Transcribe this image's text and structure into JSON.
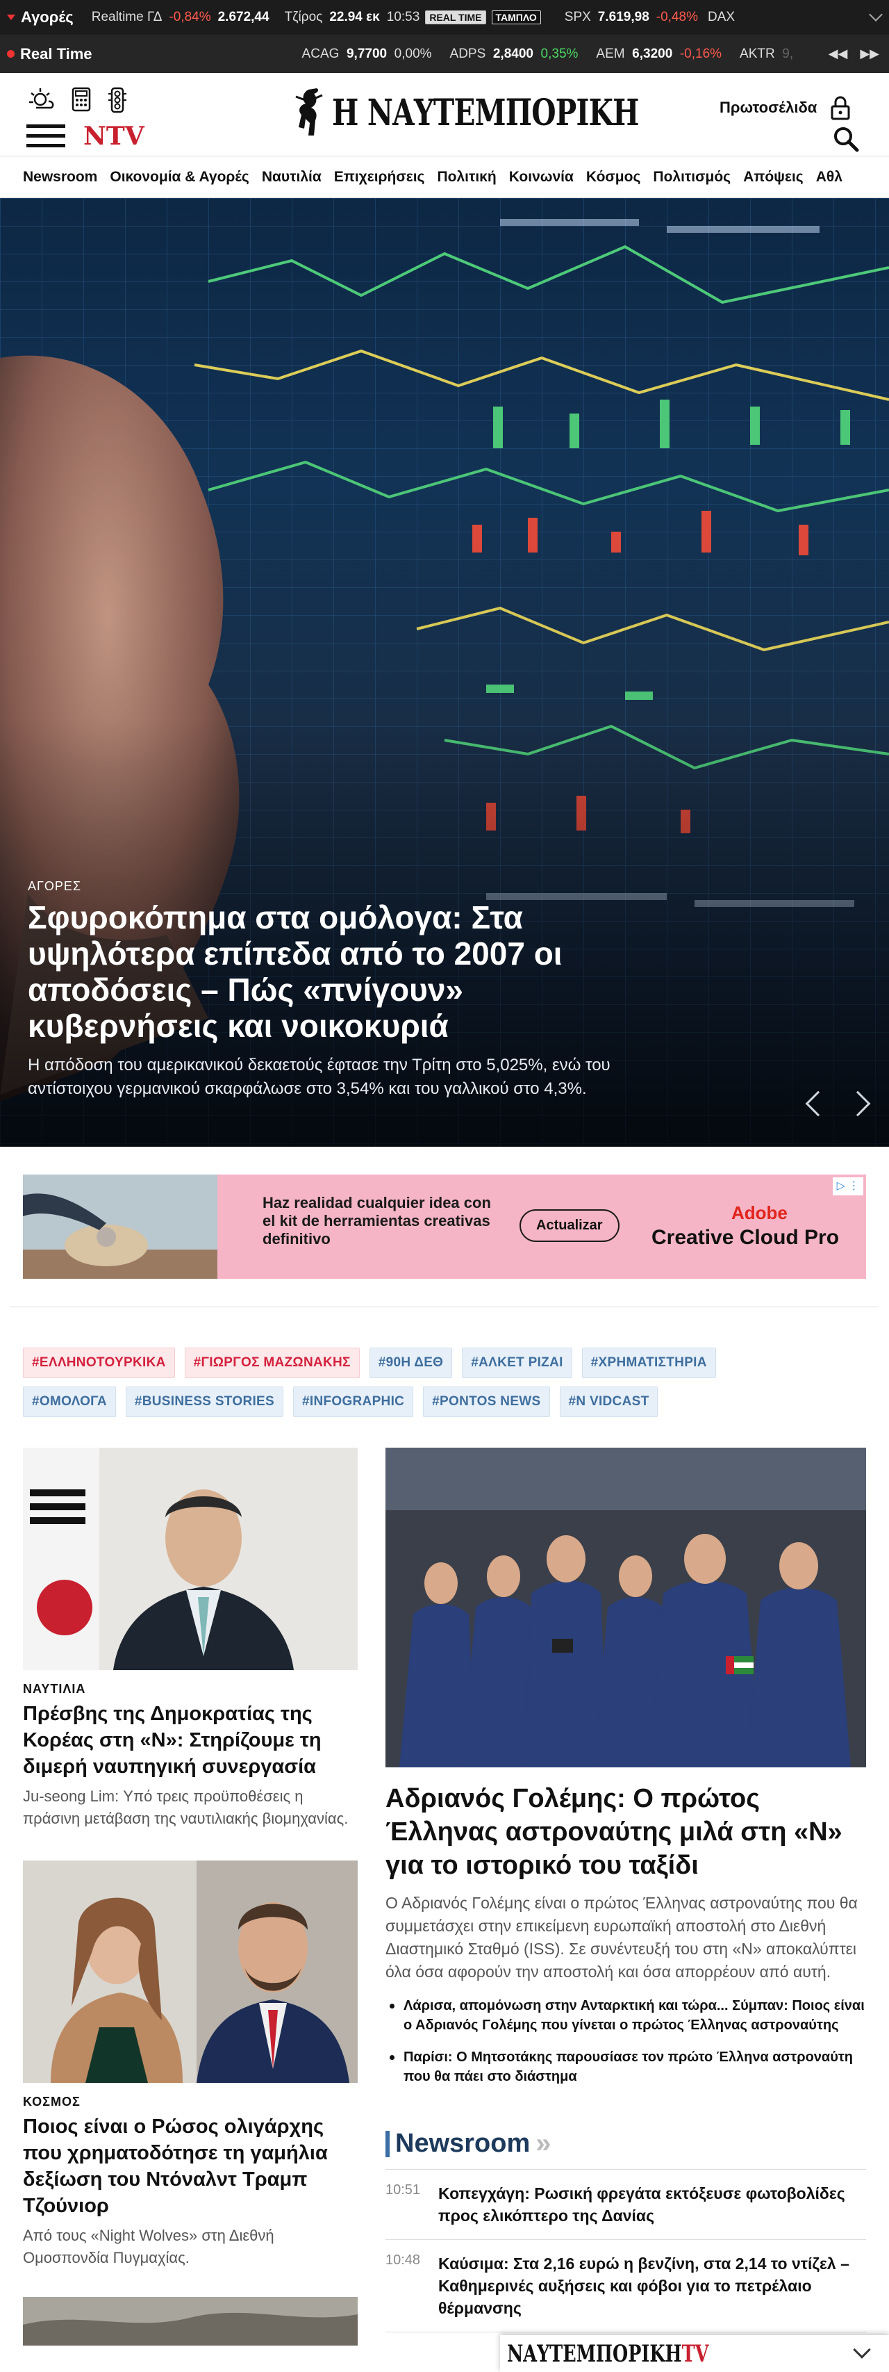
{
  "ticker_markets": {
    "label": "Αγορές",
    "index_name": "Realtime ΓΔ",
    "index_change": "-0,84%",
    "index_value": "2.672,44",
    "turnover_label": "Τζίρος",
    "turnover_value": "22.94 εκ",
    "time": "10:53",
    "realtime_badge": "REAL TIME",
    "board_badge": "ΤΑΜΠΛΟ",
    "spx_name": "SPX",
    "spx_value": "7.619,98",
    "spx_change": "-0,48%",
    "dax_name": "DAX"
  },
  "ticker_stocks": {
    "label": "Real Time",
    "items": [
      {
        "sym": "ACAG",
        "val": "9,7700",
        "chg": "0,00%"
      },
      {
        "sym": "ADPS",
        "val": "2,8400",
        "chg": "0,35%"
      },
      {
        "sym": "AEM",
        "val": "6,3200",
        "chg": "-0,16%"
      },
      {
        "sym": "AKTR",
        "val": "9,"
      }
    ],
    "prev_icon": "◀◀",
    "next_icon": "▶▶"
  },
  "header": {
    "logo_text": "Η ΝΑΥΤΕΜΠΟΡΙΚΗ",
    "ntv_label": "NTV",
    "frontpages_label": "Πρωτοσέλιδα"
  },
  "nav": [
    "Newsroom",
    "Οικονομία & Αγορές",
    "Ναυτιλία",
    "Επιχειρήσεις",
    "Πολιτική",
    "Κοινωνία",
    "Κόσμος",
    "Πολιτισμός",
    "Απόψεις",
    "Αθλ"
  ],
  "hero": {
    "kicker": "ΑΓΟΡΕΣ",
    "title": "Σφυροκόπημα στα ομόλογα: Στα υψηλότερα επίπεδα από το 2007 οι αποδόσεις – Πώς «πνίγουν» κυβερνήσεις και νοικοκυριά",
    "summary": "Η απόδοση του αμερικανικού δεκαετούς έφτασε την Τρίτη στο 5,025%, ενώ του αντίστοιχου γερμανικού σκαρφάλωσε στο 3,54% και του γαλλικού στο 4,3%."
  },
  "ad": {
    "text": "Haz realidad cualquier idea con el kit de herramientas creativas definitivo",
    "button": "Actualizar",
    "brand": "Adobe",
    "product": "Creative Cloud Pro"
  },
  "tags": [
    {
      "label": "#ΕΛΛΗΝΟΤΟΥΡΚΙΚΑ",
      "style": "r"
    },
    {
      "label": "#ΓΙΩΡΓΟΣ ΜΑΖΩΝΑΚΗΣ",
      "style": "r"
    },
    {
      "label": "#90Η ΔΕΘ",
      "style": "b"
    },
    {
      "label": "#ΑΛΚΕΤ ΡΙΖΑΙ",
      "style": "b"
    },
    {
      "label": "#ΧΡΗΜΑΤΙΣΤΗΡΙΑ",
      "style": "b"
    },
    {
      "label": "#ΟΜΟΛΟΓΑ",
      "style": "b"
    },
    {
      "label": "#BUSINESS STORIES",
      "style": "b"
    },
    {
      "label": "#INFOGRAPHIC",
      "style": "b"
    },
    {
      "label": "#PONTOS NEWS",
      "style": "b"
    },
    {
      "label": "#N VIDCAST",
      "style": "b"
    }
  ],
  "card1": {
    "category": "ΝΑΥΤΙΛΙΑ",
    "title": "Πρέσβης της Δημοκρατίας της Κορέας στη «Ν»: Στηρίζουμε τη διμερή ναυπηγική συνεργασία",
    "summary": "Ju-seong Lim: Υπό τρεις προϋποθέσεις η πράσινη μετάβαση της ναυτιλιακής βιομηχανίας."
  },
  "card2": {
    "category": "ΚΟΣΜΟΣ",
    "title": "Ποιος είναι ο Ρώσος ολιγάρχης που χρηματοδότησε τη γαμήλια δεξίωση του Ντόναλντ Τραμπ Τζούνιορ",
    "summary": "Από τους «Night Wolves» στη Διεθνή Ομοσπονδία Πυγμαχίας."
  },
  "main_story": {
    "title": "Αδριανός Γολέμης: Ο πρώτος Έλληνας αστροναύτης μιλά στη «Ν» για το ιστορικό του ταξίδι",
    "summary": "Ο Αδριανός Γολέμης είναι ο πρώτος Έλληνας αστροναύτης που θα συμμετάσχει στην επικείμενη ευρωπαϊκή αποστολή στο Διεθνή Διαστημικό Σταθμό (ISS). Σε συνέντευξή του στη «Ν» αποκαλύπτει όλα όσα αφορούν την αποστολή και όσα απορρέουν από αυτή.",
    "bullets": [
      "Λάρισα, απομόνωση στην Ανταρκτική και τώρα... Σύμπαν: Ποιος είναι ο Αδριανός Γολέμης που γίνεται ο πρώτος Έλληνας αστροναύτης",
      "Παρίσι: Ο Μητσοτάκης παρουσίασε τον πρώτο Έλληνα αστροναύτη που θα πάει στο διάστημα"
    ]
  },
  "newsroom": {
    "title": "Newsroom",
    "items": [
      {
        "time": "10:51",
        "text": "Κοπεγχάγη: Ρωσική φρεγάτα εκτόξευσε φωτοβολίδες προς ελικόπτερο της Δανίας"
      },
      {
        "time": "10:48",
        "text": "Καύσιμα: Στα 2,16 ευρώ η βενζίνη, στα 2,14 το ντίζελ – Καθημερινές αυξήσεις και φόβοι για το πετρέλαιο θέρμανσης"
      }
    ]
  },
  "ntv_bar": {
    "brand": "ΝΑΥΤΕΜΠΟΡΙΚΗ",
    "suffix": "TV"
  }
}
